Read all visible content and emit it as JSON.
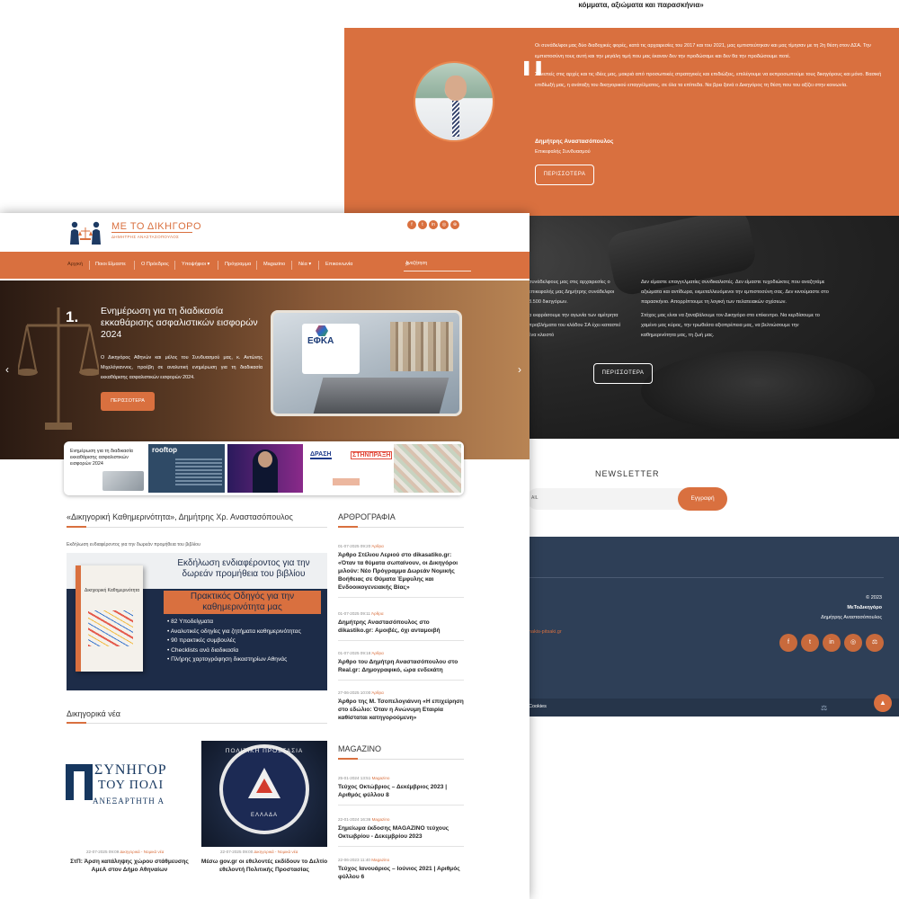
{
  "back": {
    "top_quote": "κόμματα, αξιώματα και παρασκήνια»",
    "testimonial": {
      "p1": "Οι συνάδελφοι μας δύο διαδοχικές φορές, κατά τις αρχαιρεσίες του 2017 και του 2021, μας εμπιστεύτηκαν και μας τίμησαν με τη 2η θέση στον ΔΣΑ. Την εμπιστοσύνη τους αυτή και την μεγάλη τιμή που μας έκαναν δεν την προδώσαμε και δεν θα την προδώσουμε ποτέ.",
      "p2": "Συνεπείς στις αρχές και τις ιδέες μας, μακριά από προσωπικές στρατηγικές και επιδιώξεις, επιλέγουμε να εκπροσωπούμε τους δικηγόρους και μόνο. Βασική επιδίωξή μας, η ανάταξη του δικηγορικού επαγγέλματος, σε όλα τα επίπεδα. Να βρει ξανά ο Δικηγόρος τη θέση που του αξίζει στην κοινωνία.",
      "name": "Δημήτρης Αναστασόπουλος",
      "role": "Επικεφαλής Συνδυασμού",
      "button": "ΠΕΡΙΣΣΟΤΕΡΑ"
    },
    "about": {
      "col1_p1": "συνάδελφους μας στις αρχαιρεσίες ο επικεφαλής μας Δημήτρης συνάδελφοι 3.500 δικηγόρων.",
      "col1_p2": "α εκφράσουμε την αγωνία των αμέτρητα προβλήματα του κλάδου ΣΑ έχει καταστεί ένα κλειστό",
      "col2_p1": "Δεν είμαστε επαγγελματίες συνδικαλιστές. Δεν είμαστε τυχοδιώκτες που αναζητάμε αξιώματα και αντίδωρα, εκμεταλλευόμενοι την εμπιστοσύνη σας. Δεν κινούμαστε στο παρασκήνιο. Απορρίπτουμε τη λογική των πελατειακών σχέσεων.",
      "col2_p2": "Στόχος μας είναι να ξαναβάλουμε τον Δικηγόρο στο επίκεντρο. Να κερδίσουμε το χαμένο μας κύρος, την τρωθείσα αξιοπρέπεια μας, να βελτιώσουμε την καθημερινότητα μας, τη ζωή μας.",
      "button": "ΠΕΡΙΣΣΟΤΕΡΑ"
    },
    "newsletter": {
      "title": "NEWSLETTER",
      "placeholder": "AIL",
      "button": "Εγγραφή"
    },
    "footer": {
      "year": "© 2023",
      "brand": "ΜεΤοΔικηγόρο",
      "owner": "Δημήτρης Αναστασόπουλος",
      "website": "nakis-pitsaki.gr",
      "cookies": "Cookies",
      "socials": [
        "f",
        "t",
        "in",
        "◎",
        "⚖"
      ]
    }
  },
  "front": {
    "logo": {
      "title": "ΜΕ ΤΟ ΔΙΚΗΓΟΡΟ",
      "subtitle": "ΔΗΜΗΤΡΗΣ ΑΝΑΣΤΑΣΟΠΟΥΛΟΣ"
    },
    "header_socials": [
      "f",
      "t",
      "in",
      "◎",
      "⊕"
    ],
    "nav": [
      "Αρχική",
      "Ποιοι Είμαστε",
      "Ο Πρόεδρος",
      "Υποψήφιοι ▾",
      "Πρόγραμμα",
      "Magazino",
      "Νέα ▾",
      "Επικοινωνία"
    ],
    "search_placeholder": "Αναζήτηση",
    "hero": {
      "number": "1.",
      "title": "Ενημέρωση για τη διαδικασία εκκαθάρισης ασφαλιστικών εισφορών 2024",
      "text": "Ο Δικηγόρος Αθηνών και μέλος του Συνδυασμού μας, κ. Αντώνης Μιχελόγιαννος, προέβη σε αναλυτική ενημέρωση για τη διαδικασία εκκαθάρισης ασφαλιστικών εισφορών 2024.",
      "button": "ΠΕΡΙΣΣΟΤΕΡΑ",
      "image_label": "ΕΦΚΑ",
      "prev": "‹",
      "next": "›"
    },
    "thumbs": {
      "t1": "Ενημέρωση για τη διαδικασία εκκαθάρισης ασφαλιστικών εισφορών 2024",
      "t2_head": "rooftop",
      "t4": "ΔΡΑΣΗ",
      "t5": "ΣΤΗΝΠΡΑΞΗ"
    },
    "book_section": {
      "title": "«Δικηγορική Καθημερινότητα», Δημήτρης Χρ. Αναστασόπουλος",
      "caption": "Εκδήλωση ενδιαφέροντος για την δωρεάν προμήθεια του βιβλίου",
      "banner_title": "Εκδήλωση ενδιαφέροντος για την δωρεάν προμήθεια του βιβλίου",
      "banner_sub": "Πρακτικός Οδηγός για την καθημερινότητα μας",
      "book_title": "Δικηγορική Καθημερινότητα",
      "bullets": [
        "• 82 Υποδείγματα",
        "• Αναλυτικές οδηγίες για ζητήματα καθημερινότητας",
        "• 90 πρακτικές συμβουλές",
        "• Checklists ανά διαδικασία",
        "• Πλήρης χαρτογράφηση δικαστηρίων Αθηνάς"
      ]
    },
    "news_section": {
      "title": "Δικηγορικά νέα",
      "img1_l1": "ΣΥΝΗΓΟΡ",
      "img1_l2": "ΤΟΥ ΠΟΛΙ",
      "img1_l3": "ΑΝΕΞΑΡΤΗΤΗ Α",
      "img2_top": "ΠΟΛΙΤΙΚΗ ΠΡΟΣΤΑΣΙΑ",
      "img2_bottom": "ΕΛΛΑΔΑ",
      "items": [
        {
          "date": "22-07-2025 09:09",
          "category": "Δικηγορικά - Νομικά νέα",
          "title": "ΣτΠ: Άρση κατάληψης χώρου στάθμευσης ΑμεΑ στον Δήμο Αθηναίων"
        },
        {
          "date": "22-07-2025 09:00",
          "category": "Δικηγορικά - Νομικά νέα",
          "title": "Μέσω gov.gr οι εθελοντές εκδίδουν το Δελτίο εθελοντή Πολιτικής Προστασίας"
        }
      ]
    },
    "articles": {
      "title": "ΑΡΘΡΟΓΡΑΦΙΑ",
      "items": [
        {
          "date": "01-07-2025 09:20",
          "category": "Άρθρα",
          "title": "Άρθρο Στέλιου Λεριού στο dikasatiko.gr: «Όταν τα θύματα σωπαίνουν, οι Δικηγόροι μιλούν: Νέο Πρόγραμμα Δωρεάν Νομικής Βοήθειας σε Θύματα Έμφυλης και Ενδοοικογενειακής Βίας»"
        },
        {
          "date": "01-07-2025 09:11",
          "category": "Άρθρα",
          "title": "Δημήτρης Αναστασόπουλος στο dikastiko.gr: Αμοιβές, όχι ανταμοιβή"
        },
        {
          "date": "01-07-2025 09:18",
          "category": "Άρθρα",
          "title": "Άρθρο του Δημήτρη Αναστασόπουλου στο Real.gr: Δημογραφικό, ώρα ενδεκάτη"
        },
        {
          "date": "27-06-2025 10:00",
          "category": "Άρθρα",
          "title": "Άρθρο της Μ. Τσοπελογιάννη «Η επιχείρηση στο εδώλιο: Όταν η Ανώνυμη Εταιρία καθίσταται κατηγορούμενη»"
        }
      ]
    },
    "magazino": {
      "title": "MAGAZINO",
      "items": [
        {
          "date": "25-01-2024 13:51",
          "category": "Magazino",
          "title": "Τεύχος Οκτώβριος – Δεκέμβριος 2023 | Αριθμός φύλλου 8"
        },
        {
          "date": "22-01-2024 16:36",
          "category": "Magazino",
          "title": "Σημείωμα έκδοσης MAGAZINO τεύχους Οκτωβρίου - Δεκεμβρίου 2023"
        },
        {
          "date": "22-06-2023 11:40",
          "category": "Magazino",
          "title": "Τεύχος Ιανουάριος – Ιούνιος 2021 | Αριθμός φύλλου 6"
        }
      ]
    },
    "colors": {
      "accent": "#d9703f",
      "navy": "#2e3f57",
      "dark": "#1d2c48"
    }
  }
}
